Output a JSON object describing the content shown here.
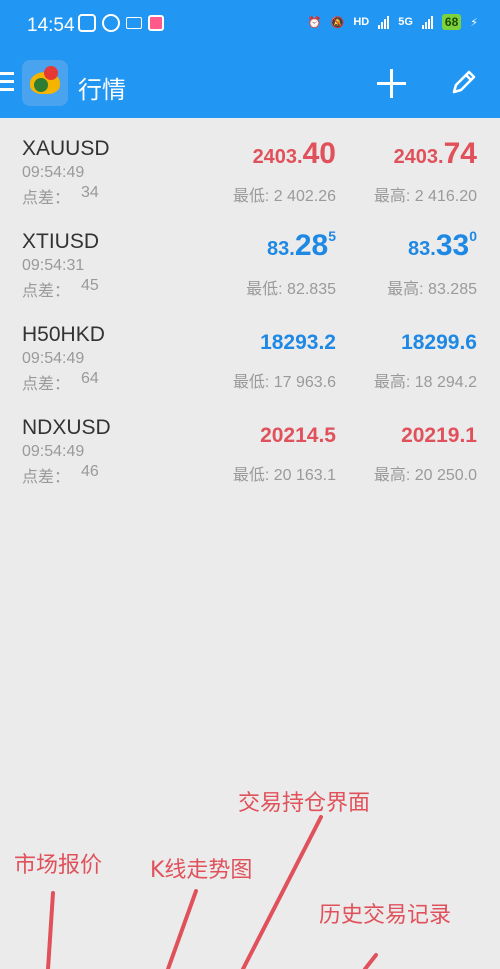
{
  "status_bar": {
    "time": "14:54",
    "network_label": "5G",
    "battery": "68"
  },
  "app_bar": {
    "title": "行情"
  },
  "quotes": [
    {
      "symbol": "XAUUSD",
      "time": "09:54:49",
      "spread_label": "点差：",
      "spread": "34",
      "bid_head": "2403.",
      "bid_tail": "40",
      "bid_sup": "",
      "ask_head": "2403.",
      "ask_tail": "74",
      "ask_sup": "",
      "low_label": "最低: 2 402.26",
      "high_label": "最高: 2 416.20",
      "color": "#e0515b"
    },
    {
      "symbol": "XTIUSD",
      "time": "09:54:31",
      "spread_label": "点差：",
      "spread": "45",
      "bid_head": "83.",
      "bid_tail": "28",
      "bid_sup": "5",
      "ask_head": "83.",
      "ask_tail": "33",
      "ask_sup": "0",
      "low_label": "最低: 82.835",
      "high_label": "最高: 83.285",
      "color": "#1e88e5"
    },
    {
      "symbol": "H50HKD",
      "time": "09:54:49",
      "spread_label": "点差：",
      "spread": "64",
      "bid": "18293.2",
      "ask": "18299.6",
      "low_label": "最低: 17 963.6",
      "high_label": "最高: 18 294.2",
      "color": "#1e88e5"
    },
    {
      "symbol": "NDXUSD",
      "time": "09:54:49",
      "spread_label": "点差：",
      "spread": "46",
      "bid": "20214.5",
      "ask": "20219.1",
      "low_label": "最低: 20 163.1",
      "high_label": "最高: 20 250.0",
      "color": "#e0515b"
    }
  ],
  "annotations": {
    "positions": "交易持仓界面",
    "quotes": "市场报价",
    "kline": "K线走势图",
    "history": "历史交易记录"
  },
  "colors": {
    "header": "#2196f3",
    "up": "#e0515b",
    "down": "#1e88e5",
    "annotation": "#e0515b"
  }
}
